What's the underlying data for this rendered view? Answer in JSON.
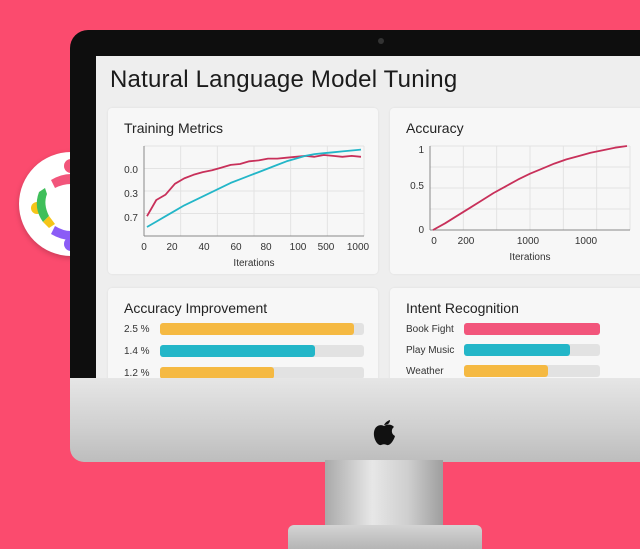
{
  "page": {
    "title": "Natural Language Model Tuning"
  },
  "colors": {
    "background": "#fb4b6e",
    "pink": "#f2557b",
    "teal": "#23b6c8",
    "yellow": "#f5b942",
    "line_red": "#c8305a",
    "line_teal": "#23b6c8"
  },
  "training_metrics": {
    "title": "Training Metrics",
    "xlabel": "Iterations",
    "y_ticks": [
      "0.0",
      "0.3",
      "0.7"
    ],
    "x_ticks": [
      "0",
      "20",
      "40",
      "60",
      "80",
      "100",
      "500",
      "1000"
    ]
  },
  "accuracy": {
    "title": "Accuracy",
    "xlabel": "Iterations",
    "y_ticks": [
      "1",
      "0.5",
      "0"
    ],
    "x_ticks": [
      "0",
      "200",
      "1000",
      "1000"
    ]
  },
  "accuracy_improvement": {
    "title": "Accuracy Improvement",
    "items": [
      {
        "label": "2.5 %",
        "fraction": 0.95,
        "color": "#f5b942"
      },
      {
        "label": "1.4 %",
        "fraction": 0.76,
        "color": "#23b6c8"
      },
      {
        "label": "1.2 %",
        "fraction": 0.56,
        "color": "#f5b942"
      }
    ]
  },
  "intent_recognition": {
    "title": "Intent Recognition",
    "items": [
      {
        "label": "Book Fight",
        "fraction": 1.0,
        "color": "#f2557b"
      },
      {
        "label": "Play Music",
        "fraction": 0.78,
        "color": "#23b6c8"
      },
      {
        "label": "Weather",
        "fraction": 0.62,
        "color": "#f5b942"
      }
    ]
  },
  "chart_data": [
    {
      "type": "line",
      "title": "Training Metrics",
      "xlabel": "Iterations",
      "ylabel": "",
      "x_tick_labels": [
        "0",
        "20",
        "40",
        "60",
        "80",
        "100",
        "500",
        "1000"
      ],
      "y_tick_labels": [
        "0.0",
        "0.3",
        "0.7"
      ],
      "grid": true,
      "series": [
        {
          "values": [
            0.22,
            0.4,
            0.46,
            0.58,
            0.64,
            0.68,
            0.71,
            0.73,
            0.76,
            0.79,
            0.8,
            0.83,
            0.84,
            0.86,
            0.86,
            0.87,
            0.88,
            0.89,
            0.88,
            0.9,
            0.89,
            0.88,
            0.89,
            0.88
          ]
        },
        {
          "values": [
            0.1,
            0.16,
            0.22,
            0.28,
            0.34,
            0.39,
            0.44,
            0.49,
            0.54,
            0.59,
            0.63,
            0.67,
            0.71,
            0.75,
            0.79,
            0.83,
            0.86,
            0.89,
            0.91,
            0.92,
            0.93,
            0.94,
            0.95,
            0.96
          ]
        }
      ]
    },
    {
      "type": "line",
      "title": "Accuracy",
      "xlabel": "Iterations",
      "ylabel": "",
      "x_tick_labels": [
        "0",
        "200",
        "1000",
        "1000"
      ],
      "y_tick_labels": [
        "1",
        "0.5",
        "0"
      ],
      "ylim": [
        0,
        1
      ],
      "grid": true,
      "series": [
        {
          "values": [
            0.0,
            0.08,
            0.17,
            0.26,
            0.35,
            0.44,
            0.52,
            0.6,
            0.67,
            0.73,
            0.79,
            0.84,
            0.88,
            0.92,
            0.95,
            0.98,
            1.0
          ]
        }
      ]
    }
  ]
}
